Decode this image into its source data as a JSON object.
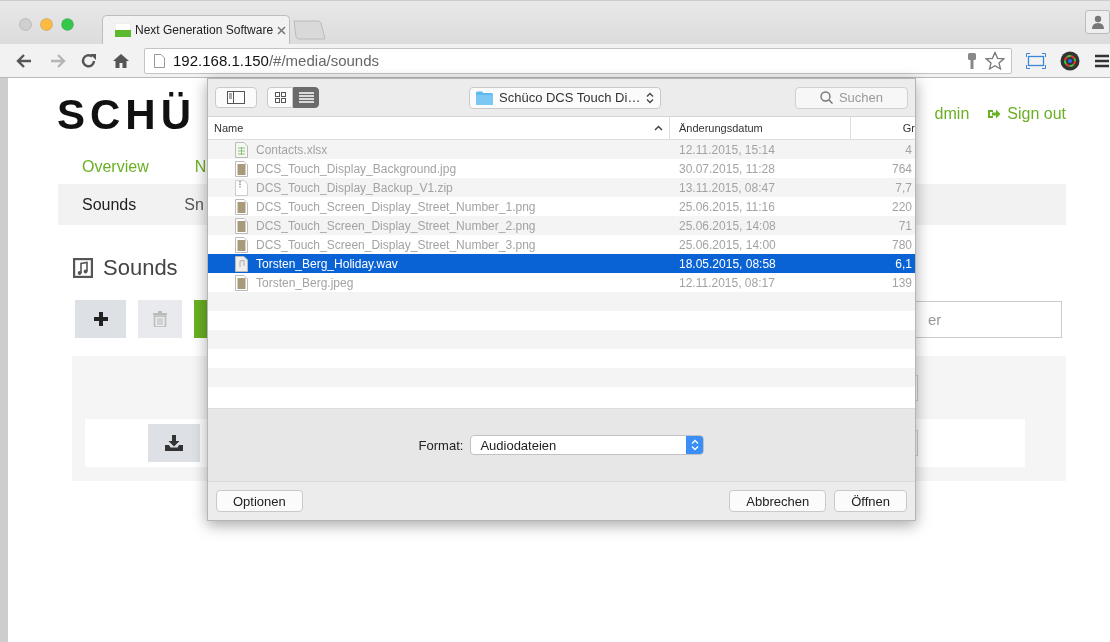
{
  "browser": {
    "tabs": [
      {
        "title": "Next Generation Software",
        "selected": true
      }
    ],
    "nav_buttons": [
      {
        "kind": "back",
        "disabled": false
      },
      {
        "kind": "forward",
        "disabled": true
      },
      {
        "kind": "reload",
        "disabled": false
      },
      {
        "kind": "home",
        "disabled": false
      }
    ],
    "url": {
      "host": "192.168.1.150",
      "path": "/#/media/sounds"
    }
  },
  "page": {
    "logo": "SCHÜ",
    "nav": [
      {
        "label": "Overview"
      },
      {
        "label": "N"
      }
    ],
    "user_links": [
      {
        "kind": "user",
        "label": "dmin"
      },
      {
        "kind": "signout",
        "label": "Sign out"
      }
    ],
    "subnav": [
      {
        "label": "Sounds",
        "selected": true
      },
      {
        "label": "Sn",
        "selected": false
      }
    ],
    "heading": "Sounds",
    "search": {
      "placeholder": "er"
    }
  },
  "dialog": {
    "view_modes": [
      {
        "kind": "icons",
        "selected": false
      },
      {
        "kind": "list",
        "selected": true
      }
    ],
    "location": "Schüco DCS Touch Di…",
    "search": {
      "placeholder": "Suchen"
    },
    "columns": [
      "Name",
      "Änderungsdatum",
      "Gr"
    ],
    "files": [
      {
        "kind": "spreadsheet",
        "name": "Contacts.xlsx",
        "modified": "12.11.2015, 15:14",
        "size": "4",
        "disabled": true,
        "selected": false
      },
      {
        "kind": "image",
        "name": "DCS_Touch_Display_Background.jpg",
        "modified": "30.07.2015, 11:28",
        "size": "764",
        "disabled": true,
        "selected": false
      },
      {
        "kind": "archive",
        "name": "DCS_Touch_Display_Backup_V1.zip",
        "modified": "13.11.2015, 08:47",
        "size": "7,7",
        "disabled": true,
        "selected": false
      },
      {
        "kind": "image",
        "name": "DCS_Touch_Screen_Display_Street_Number_1.png",
        "modified": "25.06.2015, 11:16",
        "size": "220",
        "disabled": true,
        "selected": false
      },
      {
        "kind": "image",
        "name": "DCS_Touch_Screen_Display_Street_Number_2.png",
        "modified": "25.06.2015, 14:08",
        "size": "71",
        "disabled": true,
        "selected": false
      },
      {
        "kind": "image",
        "name": "DCS_Touch_Screen_Display_Street_Number_3.png",
        "modified": "25.06.2015, 14:00",
        "size": "780",
        "disabled": true,
        "selected": false
      },
      {
        "kind": "audio",
        "name": "Torsten_Berg_Holiday.wav",
        "modified": "18.05.2015, 08:58",
        "size": "6,1",
        "disabled": false,
        "selected": true
      },
      {
        "kind": "image",
        "name": "Torsten_Berg.jpeg",
        "modified": "12.11.2015, 08:17",
        "size": "139",
        "disabled": true,
        "selected": false
      }
    ],
    "format": {
      "label": "Format:",
      "value": "Audiodateien"
    },
    "buttons": [
      {
        "kind": "options",
        "label": "Optionen"
      },
      {
        "kind": "cancel",
        "label": "Abbrechen"
      },
      {
        "kind": "open",
        "label": "Öffnen"
      }
    ]
  }
}
